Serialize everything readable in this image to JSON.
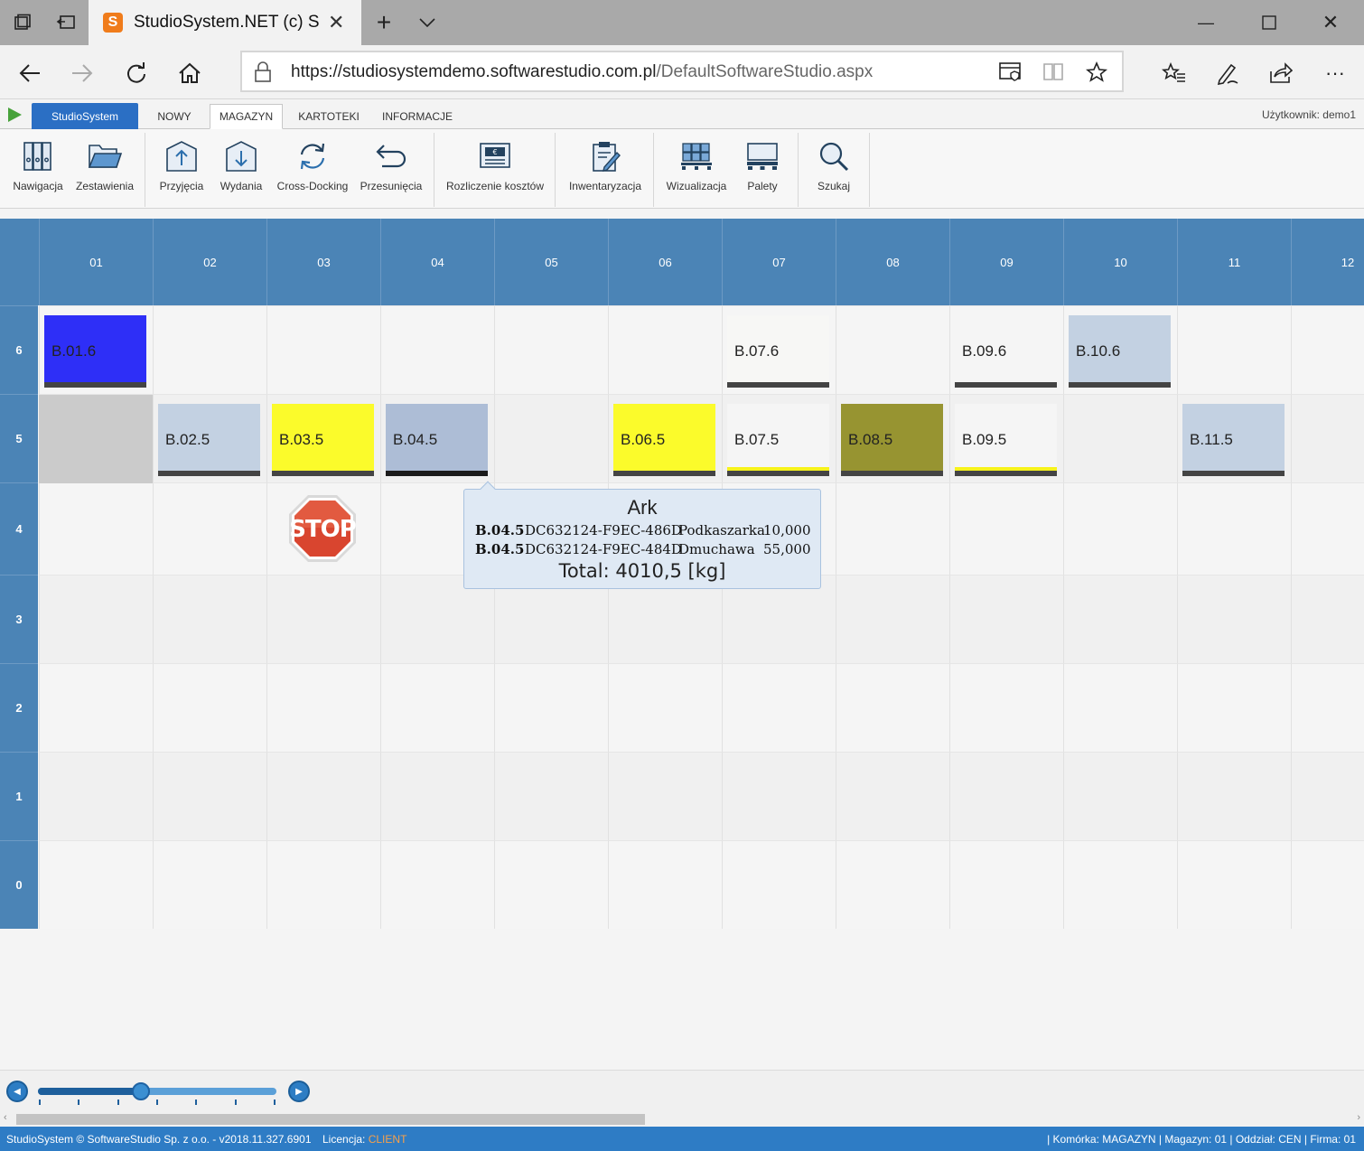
{
  "browser": {
    "tab_title": "StudioSystem.NET (c) Sc",
    "url_host": "https://studiosystemdemo.softwarestudio.com.pl",
    "url_path": "/DefaultSoftwareStudio.aspx"
  },
  "ribbon_tabs": {
    "app": "StudioSystem",
    "nowy": "NOWY",
    "magazyn": "MAGAZYN",
    "kartoteki": "KARTOTEKI",
    "informacje": "INFORMACJE",
    "user": "Użytkownik: demo1"
  },
  "toolbar": {
    "nawigacja": "Nawigacja",
    "zestawienia": "Zestawienia",
    "przyjecia": "Przyjęcia",
    "wydania": "Wydania",
    "cross_docking": "Cross-Docking",
    "przesuniecia": "Przesunięcia",
    "rozliczenie": "Rozliczenie kosztów",
    "inwentaryzacja": "Inwentaryzacja",
    "wizualizacja": "Wizualizacja",
    "palety": "Palety",
    "szukaj": "Szukaj"
  },
  "grid": {
    "columns": [
      "01",
      "02",
      "03",
      "04",
      "05",
      "06",
      "07",
      "08",
      "09",
      "10",
      "11",
      "12"
    ],
    "rows": [
      "6",
      "5",
      "4",
      "3",
      "2",
      "1",
      "0"
    ],
    "slots": {
      "b016": "B.01.6",
      "b076": "B.07.6",
      "b096": "B.09.6",
      "b106": "B.10.6",
      "b025": "B.02.5",
      "b035": "B.03.5",
      "b045": "B.04.5",
      "b065": "B.06.5",
      "b075": "B.07.5",
      "b085": "B.08.5",
      "b095": "B.09.5",
      "b115": "B.11.5"
    },
    "colors": {
      "blue": "#2e2ff7",
      "white": "#f7f7f5",
      "lightblue": "#c3d1e2",
      "steel": "#adbdd6",
      "yellow": "#fbfb2b",
      "olive": "#979431",
      "gray": "#cbcbcb"
    }
  },
  "tooltip": {
    "title": "Ark",
    "rows": [
      {
        "loc": "B.04.5",
        "code": "DC632124-F9EC-486D",
        "name": "Podkaszarka",
        "qty": "10,000"
      },
      {
        "loc": "B.04.5",
        "code": "DC632124-F9EC-484D",
        "name": "Dmuchawa",
        "qty": "55,000"
      }
    ],
    "total": "Total: 4010,5 [kg]"
  },
  "slider": {
    "value_fraction": 0.43,
    "ticks": 7
  },
  "status": {
    "left": "StudioSystem © SoftwareStudio Sp. z o.o. - v2018.11.327.6901",
    "licencja_label": "Licencja:",
    "licencja_value": "CLIENT",
    "right": "| Komórka: MAGAZYN | Magazyn: 01 | Oddział: CEN | Firma: 01"
  }
}
